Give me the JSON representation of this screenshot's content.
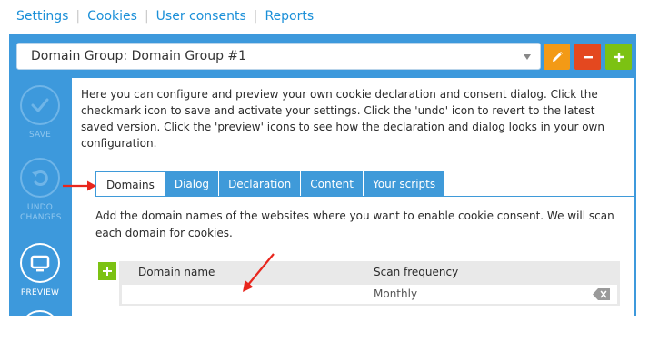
{
  "topnav": {
    "items": [
      "Settings",
      "Cookies",
      "User consents",
      "Reports"
    ]
  },
  "header": {
    "domain_group": "Domain Group: Domain Group #1",
    "buttons": {
      "edit": "pencil-icon",
      "remove": "minus-icon",
      "add": "plus-icon"
    }
  },
  "sidebar": {
    "save_label": "SAVE",
    "undo_label": "UNDO CHANGES",
    "preview_label": "PREVIEW"
  },
  "main": {
    "intro": "Here you can configure and preview your own cookie declaration and consent dialog. Click the checkmark icon to save and activate your settings. Click the 'undo' icon to revert to the latest saved version. Click the 'preview' icons to see how the declaration and dialog looks in your own configuration.",
    "tabs": [
      {
        "label": "Domains",
        "active": true
      },
      {
        "label": "Dialog",
        "active": false
      },
      {
        "label": "Declaration",
        "active": false
      },
      {
        "label": "Content",
        "active": false
      },
      {
        "label": "Your scripts",
        "active": false
      }
    ],
    "description": "Add the domain names of the websites where you want to enable cookie consent. We will scan each domain for cookies.",
    "table": {
      "headers": [
        "Domain name",
        "Scan frequency"
      ],
      "rows": [
        {
          "domain": "",
          "frequency": "Monthly"
        }
      ]
    }
  },
  "colors": {
    "panel_blue": "#3d99dc",
    "link_blue": "#1a8fd8",
    "orange": "#f39a16",
    "red": "#e4481f",
    "green": "#7cc213",
    "arrow_red": "#e8261d"
  }
}
